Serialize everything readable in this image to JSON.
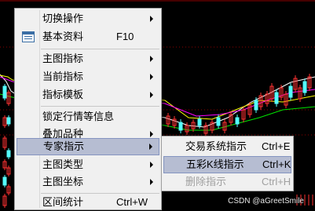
{
  "main_menu": {
    "items": [
      {
        "label": "切换操作",
        "submenu": true
      },
      {
        "label": "基本资料",
        "shortcut": "F10",
        "icon": "document-list-icon"
      },
      {
        "label": "主图指标",
        "submenu": true
      },
      {
        "label": "当前指标",
        "submenu": true
      },
      {
        "label": "指标模板",
        "submenu": true
      },
      {
        "label": "锁定行情等信息"
      },
      {
        "label": "叠加品种",
        "submenu": true
      },
      {
        "label": "专家指示",
        "submenu": true,
        "highlighted": true
      },
      {
        "label": "主图类型",
        "submenu": true
      },
      {
        "label": "主图坐标",
        "submenu": true
      },
      {
        "label": "区间统计",
        "shortcut": "Ctrl+W"
      }
    ]
  },
  "sub_menu": {
    "items": [
      {
        "label": "交易系统指示",
        "shortcut": "Ctrl+E"
      },
      {
        "label": "五彩K线指示",
        "shortcut": "Ctrl+K",
        "highlighted": true
      },
      {
        "label": "删除指示",
        "shortcut": "Ctrl+H",
        "disabled": true
      }
    ]
  },
  "watermark": "CSDN @aGreetSmile",
  "colors": {
    "menu_bg": "#f0f0f0",
    "highlight_bg": "#b6bdd2",
    "highlight_border": "#8494c0",
    "chart_bg": "#000000",
    "candle_up": "#ff3232",
    "candle_down": "#54fcfc",
    "ma_white": "#ffffff",
    "ma_yellow": "#ffff00",
    "ma_magenta": "#ff00ff",
    "ma_green": "#00e600",
    "grid_red": "#8b0000"
  }
}
